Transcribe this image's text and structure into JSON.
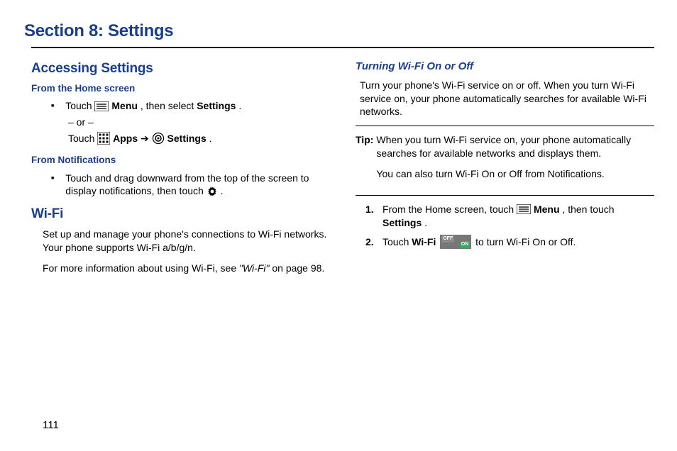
{
  "section_title": "Section 8: Settings",
  "page_number": "111",
  "left": {
    "h1": "Accessing Settings",
    "sub1": "From the Home screen",
    "bullet1_a": "Touch ",
    "bullet1_b_bold": "Menu",
    "bullet1_c": ", then select ",
    "bullet1_d_bold": "Settings",
    "bullet1_e": ".",
    "or": "– or –",
    "bullet1_f": "Touch ",
    "bullet1_g_bold": "Apps",
    "bullet1_arrow": " ➔ ",
    "bullet1_h_bold": "Settings",
    "bullet1_i": ".",
    "sub2": "From Notifications",
    "bullet2_a": "Touch and drag downward from the top of the screen to display notifications, then touch ",
    "bullet2_b": ".",
    "h1b": "Wi-Fi",
    "body1": "Set up and manage your phone's connections to Wi-Fi networks. Your phone supports Wi-Fi a/b/g/n.",
    "body2_a": "For more information about using Wi-Fi, see ",
    "body2_b_italic": "\"Wi-Fi\"",
    "body2_c": " on page 98."
  },
  "right": {
    "h3": "Turning Wi-Fi On or Off",
    "body1": "Turn your phone's Wi-Fi service on or off. When you turn Wi-Fi service on, your phone automatically searches for available Wi-Fi networks.",
    "tip_label": "Tip:",
    "tip_body1": "When you turn Wi-Fi service on, your phone automatically searches for available networks and displays them.",
    "tip_body2": "You can also turn Wi-Fi On or Off from Notifications.",
    "step1_num": "1.",
    "step1_a": "From the Home screen, touch ",
    "step1_b_bold": "Menu",
    "step1_c": ", then touch ",
    "step1_d_bold": "Settings",
    "step1_e": ".",
    "step2_num": "2.",
    "step2_a": "Touch ",
    "step2_b_bold": "Wi-Fi",
    "step2_c": " ",
    "step2_d": " to turn Wi-Fi On or Off.",
    "toggle_off": "OFF",
    "toggle_on": "ON"
  }
}
